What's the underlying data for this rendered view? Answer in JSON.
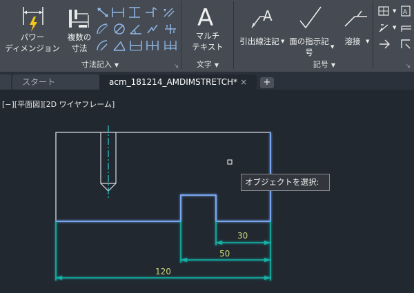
{
  "ribbon": {
    "power_dim_label": "パワー\nディメンジョン",
    "multi_dim_label": "複数の\n寸法",
    "panel_dimension_title": "寸法記入",
    "multitext_label": "マルチ\nテキスト",
    "panel_text_title": "文字",
    "leader_label": "引出線注記",
    "surface_label": "面の指示記\n号",
    "weld_label": "溶接",
    "panel_symbol_title": "記号"
  },
  "tabs": [
    {
      "label": "スタート",
      "active": false
    },
    {
      "label": "acm_181214_AMDIMSTRETCH*",
      "active": true
    }
  ],
  "tab_close_icon": "×",
  "tab_add_icon": "+",
  "viewport_label": "[−][平面図][2D ワイヤフレーム]",
  "tooltip": "オブジェクトを選択:",
  "drawing": {
    "dimensions": [
      {
        "value": "30"
      },
      {
        "value": "50"
      },
      {
        "value": "120"
      }
    ]
  },
  "colors": {
    "ribbon_bg": "#464b53",
    "canvas_bg": "#212830",
    "selected_line": "#7fb0ff",
    "dimension_line": "#14b4a8",
    "dimension_text": "#c8d878",
    "centerline": "#2ec8d8"
  }
}
